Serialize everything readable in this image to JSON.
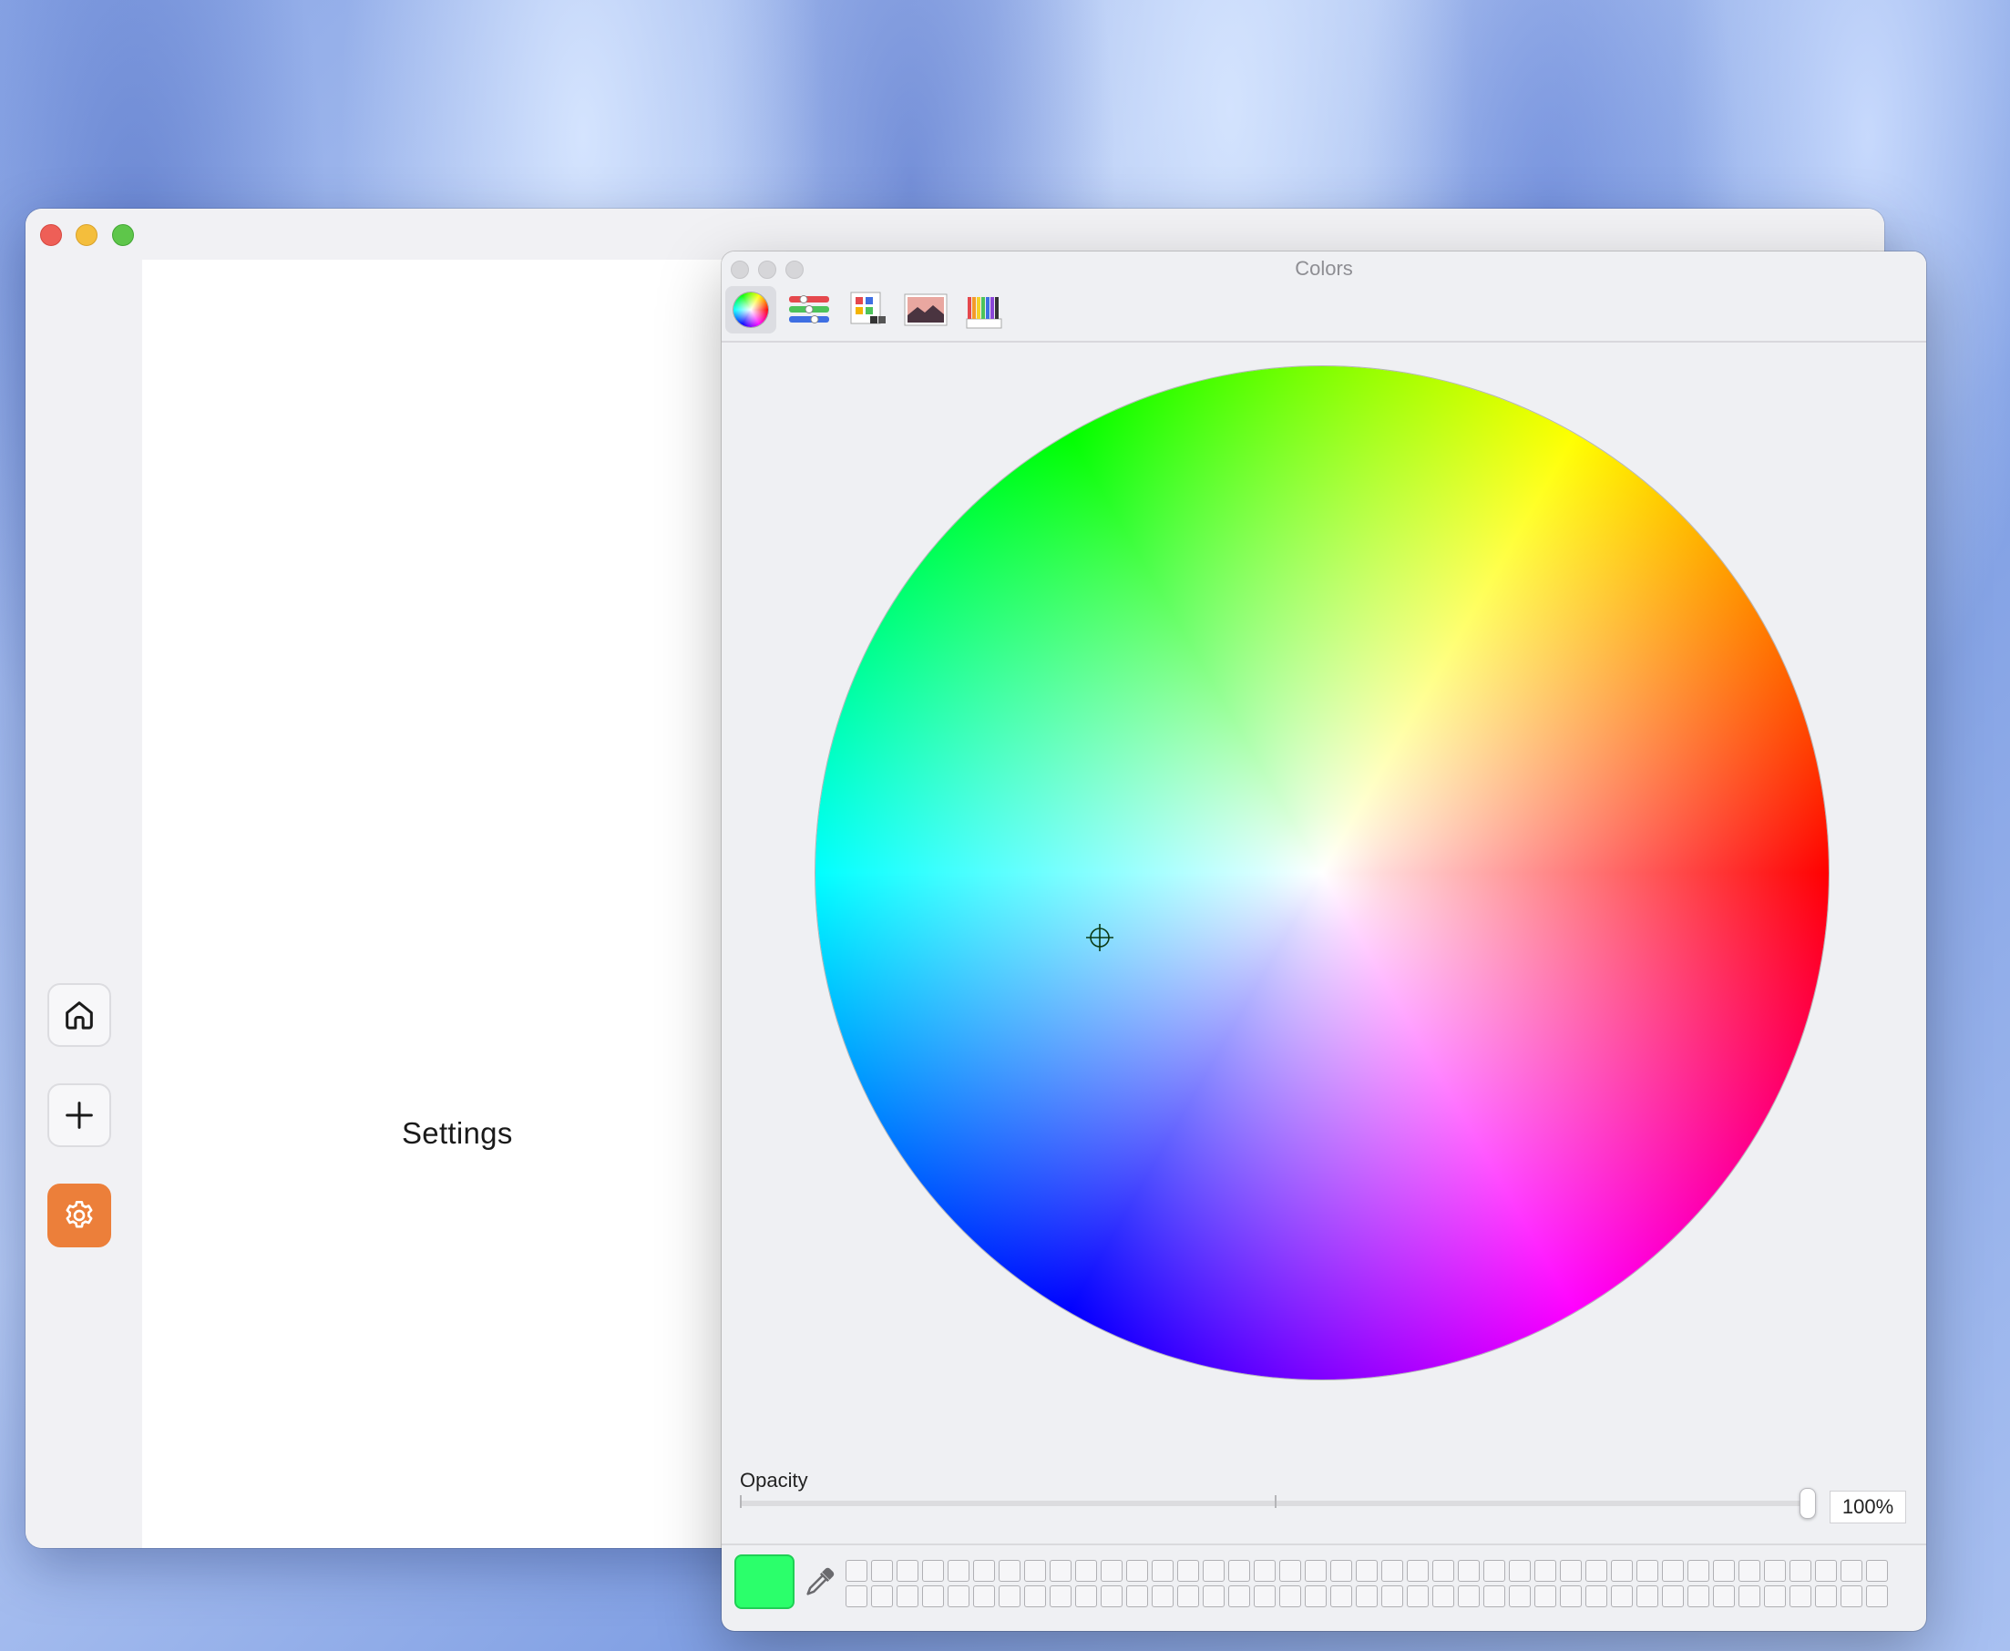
{
  "app": {
    "window_controls": [
      "close",
      "minimize",
      "zoom"
    ],
    "sidebar": {
      "items": [
        {
          "name": "home",
          "icon": "house-icon"
        },
        {
          "name": "add",
          "icon": "plus-icon"
        },
        {
          "name": "settings",
          "icon": "gear-icon",
          "active": true
        }
      ],
      "active_color": "#ec7f3a"
    },
    "content": {
      "title": "Settings"
    }
  },
  "colors_panel": {
    "title": "Colors",
    "modes": [
      {
        "name": "color-wheel",
        "icon": "color-wheel-icon",
        "selected": true
      },
      {
        "name": "color-sliders",
        "icon": "sliders-icon"
      },
      {
        "name": "color-palettes",
        "icon": "palettes-icon"
      },
      {
        "name": "image-palettes",
        "icon": "image-icon"
      },
      {
        "name": "pencils",
        "icon": "pencils-icon"
      }
    ],
    "brightness": {
      "value": 1.0
    },
    "opacity": {
      "label": "Opacity",
      "value_text": "100%",
      "value": 1.0
    },
    "current_color": "#2bff6b",
    "swatch_rows": 2,
    "swatch_cols": 41
  }
}
